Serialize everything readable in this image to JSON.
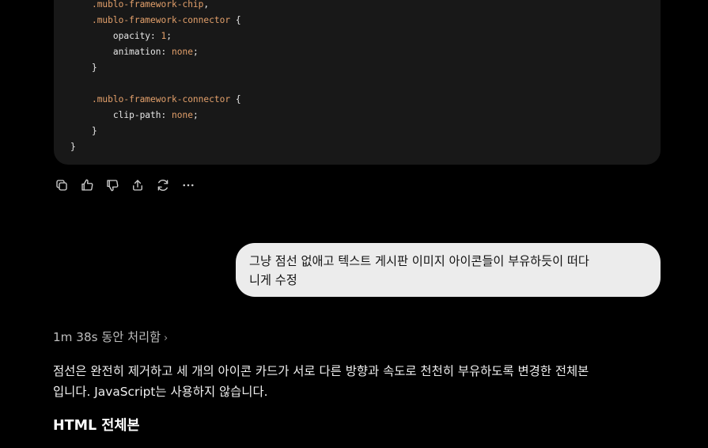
{
  "code_block": {
    "lines": [
      {
        "indent": "    ",
        "parts": [
          {
            "t": ".mublo-framework-chip",
            "c": "sel"
          },
          {
            "t": ",",
            "c": "prop"
          }
        ]
      },
      {
        "indent": "    ",
        "parts": [
          {
            "t": ".mublo-framework-connector",
            "c": "sel"
          },
          {
            "t": " {",
            "c": "prop"
          }
        ]
      },
      {
        "indent": "        ",
        "parts": [
          {
            "t": "opacity: ",
            "c": "prop"
          },
          {
            "t": "1",
            "c": "num"
          },
          {
            "t": ";",
            "c": "prop"
          }
        ]
      },
      {
        "indent": "        ",
        "parts": [
          {
            "t": "animation: ",
            "c": "prop"
          },
          {
            "t": "none",
            "c": "kw"
          },
          {
            "t": ";",
            "c": "prop"
          }
        ]
      },
      {
        "indent": "    ",
        "parts": [
          {
            "t": "}",
            "c": "prop"
          }
        ]
      },
      {
        "indent": "",
        "parts": []
      },
      {
        "indent": "    ",
        "parts": [
          {
            "t": ".mublo-framework-connector",
            "c": "sel"
          },
          {
            "t": " {",
            "c": "prop"
          }
        ]
      },
      {
        "indent": "        ",
        "parts": [
          {
            "t": "clip-path: ",
            "c": "prop"
          },
          {
            "t": "none",
            "c": "kw"
          },
          {
            "t": ";",
            "c": "prop"
          }
        ]
      },
      {
        "indent": "    ",
        "parts": [
          {
            "t": "}",
            "c": "prop"
          }
        ]
      },
      {
        "indent": "",
        "parts": [
          {
            "t": "}",
            "c": "prop"
          }
        ]
      }
    ]
  },
  "actions": [
    {
      "name": "copy-icon"
    },
    {
      "name": "thumbs-up-icon"
    },
    {
      "name": "thumbs-down-icon"
    },
    {
      "name": "share-icon"
    },
    {
      "name": "regenerate-icon"
    },
    {
      "name": "more-icon"
    }
  ],
  "user_message": {
    "line1": "그냥 점선 없애고 텍스트 게시판 이미지 아이콘들이 부유하듯이 떠다",
    "line2": "니게 수정"
  },
  "thinking": {
    "label": "1m 38s 동안 처리함",
    "chevron": "›"
  },
  "response": {
    "line1": "점선은 완전히 제거하고 세 개의 아이콘 카드가 서로 다른 방향과 속도로 천천히 부유하도록 변경한 전체본",
    "line2": "입니다. JavaScript는 사용하지 않습니다.",
    "heading": "HTML 전체본"
  },
  "colors": {
    "background": "#000000",
    "code_bg": "#181818",
    "bubble_bg": "#ececec",
    "code_accent": "#e3a06b"
  }
}
